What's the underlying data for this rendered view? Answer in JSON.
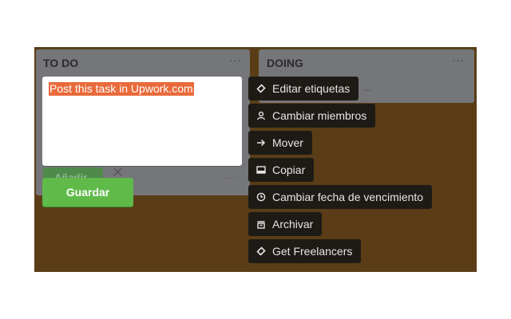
{
  "lists": [
    {
      "title": "TO DO",
      "menu": "···"
    },
    {
      "title": "DOING",
      "menu": "···"
    }
  ],
  "doing_card_fragment": "...",
  "editor": {
    "text": "Post this task in Upwork.com"
  },
  "ghost": {
    "add_label": "Añadir",
    "close": "✕",
    "dots": "···"
  },
  "save_label": "Guardar",
  "menu": [
    {
      "label": "Editar etiquetas",
      "icon": "tag-icon"
    },
    {
      "label": "Cambiar miembros",
      "icon": "person-icon"
    },
    {
      "label": "Mover",
      "icon": "arrow-right-icon"
    },
    {
      "label": "Copiar",
      "icon": "card-icon"
    },
    {
      "label": "Cambiar fecha de vencimiento",
      "icon": "clock-icon"
    },
    {
      "label": "Archivar",
      "icon": "archive-icon"
    },
    {
      "label": "Get Freelancers",
      "icon": "tag-icon"
    }
  ],
  "colors": {
    "board": "#5a3d17",
    "list": "#757679",
    "save": "#5fba4a",
    "highlight": "#e96a3a",
    "menu": "#1e1b16"
  }
}
